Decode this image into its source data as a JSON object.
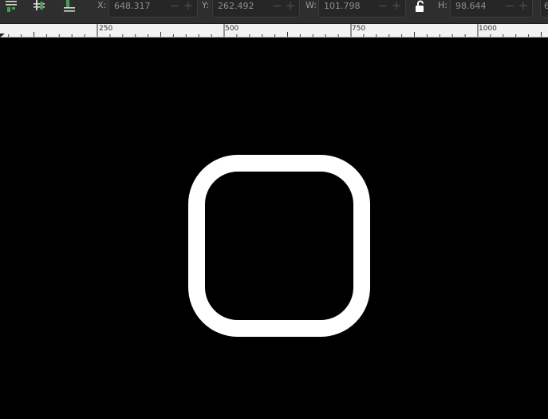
{
  "toolbar": {
    "buttons": [
      {
        "name": "align-top-icon"
      },
      {
        "name": "align-vertical-center-icon"
      },
      {
        "name": "align-bottom-icon"
      }
    ],
    "x": {
      "label": "X:",
      "value": "648.317"
    },
    "y": {
      "label": "Y:",
      "value": "262.492"
    },
    "w": {
      "label": "W:",
      "value": "101.798"
    },
    "h": {
      "label": "H:",
      "value": "98.644"
    },
    "lock": {
      "icon": "lock-open-icon",
      "state": "unlocked"
    },
    "next_field_partial": "6"
  },
  "ruler": {
    "labels": [
      "250",
      "500",
      "750",
      "1000"
    ]
  },
  "canvas": {
    "background": "#000000",
    "shape": {
      "type": "rounded-square-outline",
      "stroke": "#ffffff"
    }
  },
  "colors": {
    "toolbar_bg": "#2e2e2e",
    "field_bg": "#262626",
    "ruler_bg": "#f2f2f2",
    "icon_accent": "#3fa34d"
  }
}
